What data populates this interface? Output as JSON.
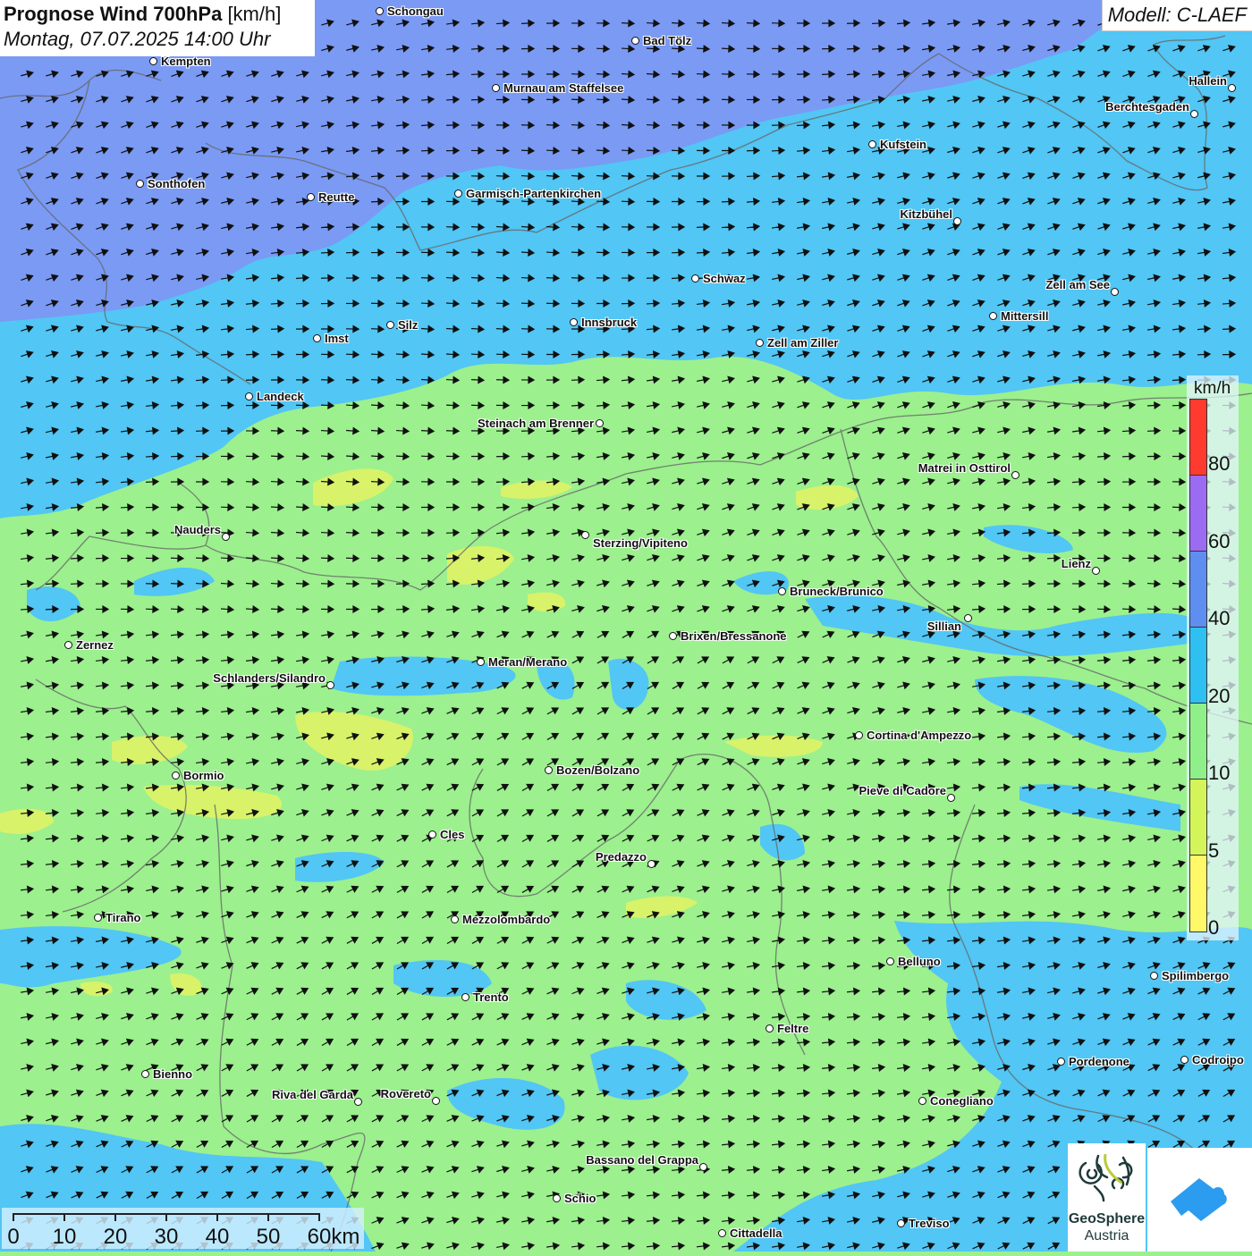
{
  "header": {
    "title_bold": "Prognose Wind 700hPa",
    "title_unit": "[km/h]",
    "subtitle": "Montag, 07.07.2025 14:00 Uhr",
    "model": "Modell: C-LAEF"
  },
  "legend": {
    "unit": "km/h",
    "ticks": [
      "80",
      "60",
      "40",
      "20",
      "10",
      "5",
      "0"
    ],
    "colors": [
      "#ff3b30",
      "#9b6cf2",
      "#5e8ff0",
      "#2fc0f2",
      "#8ff08a",
      "#d4f55a",
      "#fff96a"
    ]
  },
  "scale_bar": {
    "labels": [
      "0",
      "10",
      "20",
      "30",
      "40",
      "50",
      "60km"
    ]
  },
  "cities": [
    "Schongau",
    "Bad Tölz",
    "Kempten",
    "Murnau am Staffelsee",
    "Hallein",
    "Berchtesgaden",
    "Kufstein",
    "Sonthofen",
    "Reutte",
    "Garmisch-Partenkirchen",
    "Kitzbühel",
    "Schwaz",
    "Zell am See",
    "Mittersill",
    "Innsbruck",
    "Silz",
    "Imst",
    "Zell am Ziller",
    "Landeck",
    "Steinach am Brenner",
    "Matrei in Osttirol",
    "Nauders",
    "Sterzing/Vipiteno",
    "Lienz",
    "Bruneck/Brunico",
    "Sillian",
    "Brixen/Bressanone",
    "Zernez",
    "Meran/Merano",
    "Schlanders/Silandro",
    "Cortina d'Ampezzo",
    "Bozen/Bolzano",
    "Bormio",
    "Pieve di Cadore",
    "Cles",
    "Predazzo",
    "Tirano",
    "Mezzolombardo",
    "Belluno",
    "Spilimbergo",
    "Trento",
    "Feltre",
    "Pordenone",
    "Codroipo",
    "Bienno",
    "Riva del Garda",
    "Rovereto",
    "Conegliano",
    "Bassano del Grappa",
    "Schio",
    "Treviso",
    "Cittadella"
  ],
  "colors": {
    "wind_40_60": "#7a9af4",
    "wind_20_40": "#52c6f4",
    "wind_10_20": "#9cf08e",
    "wind_5_10": "#d8f26a"
  },
  "logos": {
    "geosphere_line1": "GeoSphere",
    "geosphere_line2": "Austria"
  }
}
